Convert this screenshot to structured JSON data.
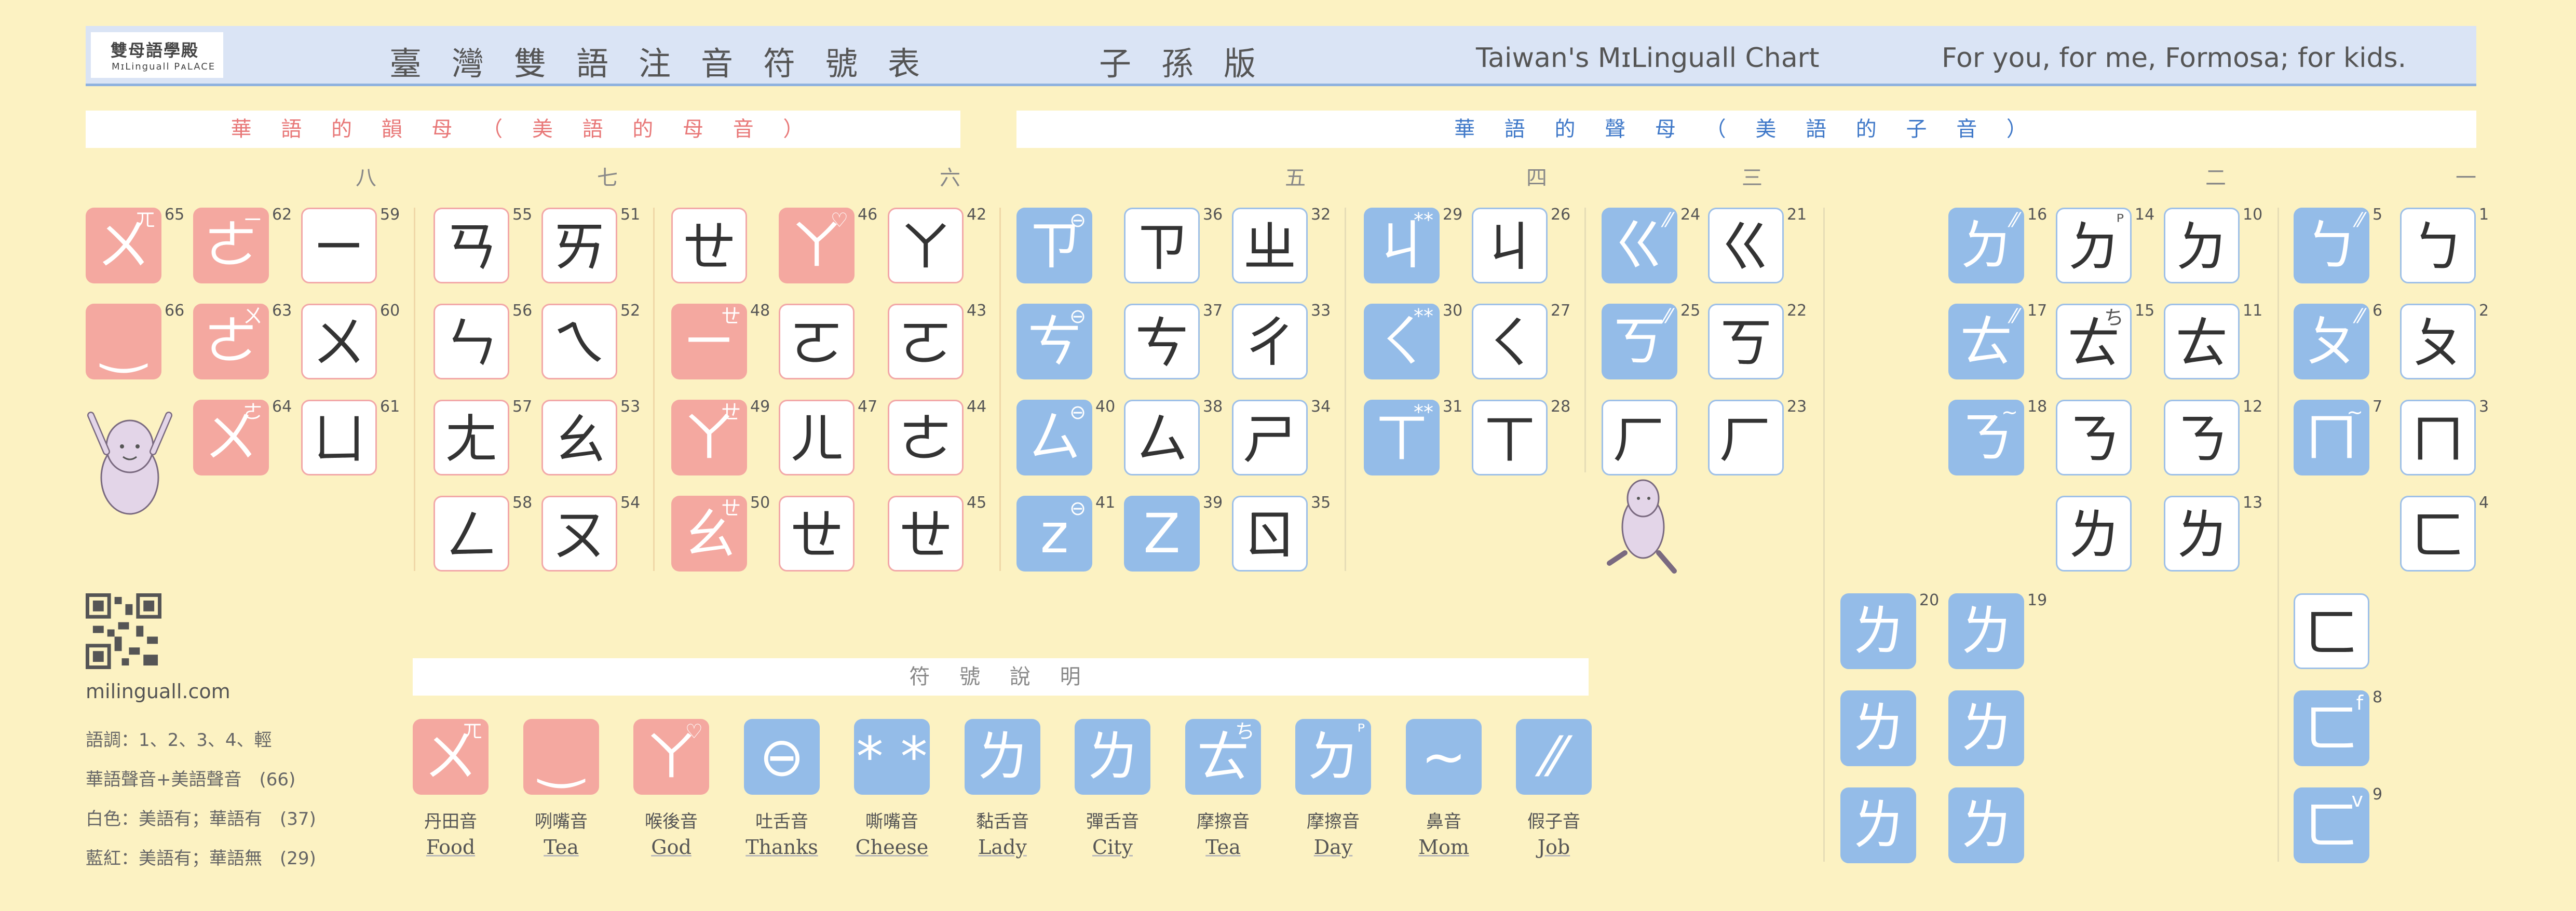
{
  "header": {
    "logo_main": "雙母語學殿",
    "logo_sub": "MɪLinguall PᴀLACE",
    "title_parts": [
      "臺灣雙語注音符號表",
      "子孫版"
    ],
    "title_en": "Taiwan's MɪLinguall Chart",
    "slogan": "For you, for me, Formosa; for kids."
  },
  "sections": {
    "vowels_bar": "華 語 的 韻 母 （ 美 語 的 母 音 ）",
    "consonants_bar": "華 語 的 聲 母 （ 美 語 的 子 音 ）",
    "legend_bar": "符 號 說 明"
  },
  "column_numbers": [
    "八",
    "七",
    "六",
    "五",
    "四",
    "三",
    "二",
    "一"
  ],
  "tiles": [
    {
      "id": "t1",
      "glyph": "ㄅ",
      "num": "1",
      "style": "w-b",
      "mark": ""
    },
    {
      "id": "t2",
      "glyph": "ㄆ",
      "num": "2",
      "style": "w-b",
      "mark": ""
    },
    {
      "id": "t3",
      "glyph": "ㄇ",
      "num": "3",
      "style": "w-b",
      "mark": ""
    },
    {
      "id": "t4",
      "glyph": "ㄈ",
      "num": "4",
      "style": "w-b",
      "mark": ""
    },
    {
      "id": "t5",
      "glyph": "ㄅ",
      "num": "5",
      "style": "f-b",
      "mark": "⁄⁄"
    },
    {
      "id": "t6",
      "glyph": "ㄆ",
      "num": "6",
      "style": "f-b",
      "mark": "⁄⁄"
    },
    {
      "id": "t7",
      "glyph": "ㄇ",
      "num": "7",
      "style": "f-b",
      "mark": "~"
    },
    {
      "id": "t8",
      "glyph": "ㄈ",
      "num": "8",
      "style": "f-b",
      "mark": "f"
    },
    {
      "id": "t9",
      "glyph": "ㄈ",
      "num": "9",
      "style": "f-b",
      "mark": "v"
    },
    {
      "id": "t9b",
      "glyph": "ㄈ",
      "num": "",
      "style": "w-b",
      "mark": ""
    },
    {
      "id": "t10",
      "glyph": "ㄉ",
      "num": "10",
      "style": "w-b",
      "mark": ""
    },
    {
      "id": "t11",
      "glyph": "ㄊ",
      "num": "11",
      "style": "w-b",
      "mark": ""
    },
    {
      "id": "t12",
      "glyph": "ㄋ",
      "num": "12",
      "style": "w-b",
      "mark": ""
    },
    {
      "id": "t13",
      "glyph": "ㄌ",
      "num": "13",
      "style": "w-b",
      "mark": ""
    },
    {
      "id": "t14",
      "glyph": "ㄉ",
      "num": "14",
      "style": "w-b",
      "mark": "ᴾ"
    },
    {
      "id": "t15",
      "glyph": "ㄊ",
      "num": "15",
      "style": "w-b",
      "mark": "ち"
    },
    {
      "id": "t13b",
      "glyph": "ㄋ",
      "num": "",
      "style": "w-b",
      "mark": ""
    },
    {
      "id": "t13c",
      "glyph": "ㄌ",
      "num": "",
      "style": "w-b",
      "mark": ""
    },
    {
      "id": "t16",
      "glyph": "ㄉ",
      "num": "16",
      "style": "f-b",
      "mark": "⁄⁄"
    },
    {
      "id": "t17",
      "glyph": "ㄊ",
      "num": "17",
      "style": "f-b",
      "mark": "⁄⁄"
    },
    {
      "id": "t18",
      "glyph": "ㄋ",
      "num": "18",
      "style": "f-b",
      "mark": "~"
    },
    {
      "id": "t19",
      "glyph": "ㄌ",
      "num": "19",
      "style": "f-b",
      "mark": ""
    },
    {
      "id": "t20",
      "glyph": "ㄌ",
      "num": "20",
      "style": "f-b",
      "mark": ""
    },
    {
      "id": "t21",
      "glyph": "ㄍ",
      "num": "21",
      "style": "w-b",
      "mark": ""
    },
    {
      "id": "t22",
      "glyph": "ㄎ",
      "num": "22",
      "style": "w-b",
      "mark": ""
    },
    {
      "id": "t23",
      "glyph": "ㄏ",
      "num": "23",
      "style": "w-b",
      "mark": ""
    },
    {
      "id": "t24",
      "glyph": "ㄍ",
      "num": "24",
      "style": "f-b",
      "mark": "⁄⁄"
    },
    {
      "id": "t25",
      "glyph": "ㄎ",
      "num": "25",
      "style": "f-b",
      "mark": "⁄⁄"
    },
    {
      "id": "t23b",
      "glyph": "ㄏ",
      "num": "",
      "style": "w-b",
      "mark": ""
    },
    {
      "id": "t26",
      "glyph": "ㄐ",
      "num": "26",
      "style": "w-b",
      "mark": ""
    },
    {
      "id": "t27",
      "glyph": "ㄑ",
      "num": "27",
      "style": "w-b",
      "mark": ""
    },
    {
      "id": "t28",
      "glyph": "ㄒ",
      "num": "28",
      "style": "w-b",
      "mark": ""
    },
    {
      "id": "t29",
      "glyph": "ㄐ",
      "num": "29",
      "style": "f-b",
      "mark": "**"
    },
    {
      "id": "t30",
      "glyph": "ㄑ",
      "num": "30",
      "style": "f-b",
      "mark": "**"
    },
    {
      "id": "t31",
      "glyph": "ㄒ",
      "num": "31",
      "style": "f-b",
      "mark": "**"
    },
    {
      "id": "t32",
      "glyph": "ㄓ",
      "num": "32",
      "style": "w-b",
      "mark": ""
    },
    {
      "id": "t33",
      "glyph": "ㄔ",
      "num": "33",
      "style": "w-b",
      "mark": ""
    },
    {
      "id": "t34",
      "glyph": "ㄕ",
      "num": "34",
      "style": "w-b",
      "mark": ""
    },
    {
      "id": "t35",
      "glyph": "ㄖ",
      "num": "35",
      "style": "w-b",
      "mark": ""
    },
    {
      "id": "t36",
      "glyph": "ㄗ",
      "num": "36",
      "style": "w-b",
      "mark": ""
    },
    {
      "id": "t37",
      "glyph": "ㄘ",
      "num": "37",
      "style": "w-b",
      "mark": ""
    },
    {
      "id": "t38",
      "glyph": "ㄙ",
      "num": "38",
      "style": "w-b",
      "mark": ""
    },
    {
      "id": "t39",
      "glyph": "Z",
      "num": "39",
      "style": "f-b",
      "mark": ""
    },
    {
      "id": "t36b",
      "glyph": "ㄗ",
      "num": "",
      "style": "f-b",
      "mark": "⊖"
    },
    {
      "id": "t37b",
      "glyph": "ㄘ",
      "num": "",
      "style": "f-b",
      "mark": "⊖"
    },
    {
      "id": "t40",
      "glyph": "ㄙ",
      "num": "40",
      "style": "f-b",
      "mark": "⊖"
    },
    {
      "id": "t41",
      "glyph": "z",
      "num": "41",
      "style": "f-b",
      "mark": "⊖"
    },
    {
      "id": "t42",
      "glyph": "ㄚ",
      "num": "42",
      "style": "w-r",
      "mark": ""
    },
    {
      "id": "t43",
      "glyph": "ㄛ",
      "num": "43",
      "style": "w-r",
      "mark": ""
    },
    {
      "id": "t44",
      "glyph": "ㄜ",
      "num": "44",
      "style": "w-r",
      "mark": ""
    },
    {
      "id": "t45",
      "glyph": "ㄝ",
      "num": "45",
      "style": "w-r",
      "mark": ""
    },
    {
      "id": "t46",
      "glyph": "ㄚ",
      "num": "46",
      "style": "f-r",
      "mark": "♡"
    },
    {
      "id": "t43b",
      "glyph": "ㄛ",
      "num": "",
      "style": "w-r",
      "mark": ""
    },
    {
      "id": "t47",
      "glyph": "ㄦ",
      "num": "47",
      "style": "w-r",
      "mark": ""
    },
    {
      "id": "t45b",
      "glyph": "ㄝ",
      "num": "",
      "style": "w-r",
      "mark": ""
    },
    {
      "id": "t45c",
      "glyph": "ㄝ",
      "num": "",
      "style": "w-r",
      "mark": ""
    },
    {
      "id": "t48",
      "glyph": "ㄧ",
      "num": "48",
      "style": "f-r",
      "mark": "ㄝ"
    },
    {
      "id": "t49",
      "glyph": "ㄚ",
      "num": "49",
      "style": "f-r",
      "mark": "ㄝ"
    },
    {
      "id": "t50",
      "glyph": "ㄠ",
      "num": "50",
      "style": "f-r",
      "mark": "ㄝ"
    },
    {
      "id": "t51",
      "glyph": "ㄞ",
      "num": "51",
      "style": "w-r",
      "mark": ""
    },
    {
      "id": "t52",
      "glyph": "ㄟ",
      "num": "52",
      "style": "w-r",
      "mark": ""
    },
    {
      "id": "t53",
      "glyph": "ㄠ",
      "num": "53",
      "style": "w-r",
      "mark": ""
    },
    {
      "id": "t54",
      "glyph": "ㄡ",
      "num": "54",
      "style": "w-r",
      "mark": ""
    },
    {
      "id": "t55",
      "glyph": "ㄢ",
      "num": "55",
      "style": "w-r",
      "mark": ""
    },
    {
      "id": "t56",
      "glyph": "ㄣ",
      "num": "56",
      "style": "w-r",
      "mark": ""
    },
    {
      "id": "t57",
      "glyph": "ㄤ",
      "num": "57",
      "style": "w-r",
      "mark": ""
    },
    {
      "id": "t58",
      "glyph": "ㄥ",
      "num": "58",
      "style": "w-r",
      "mark": ""
    },
    {
      "id": "t59",
      "glyph": "ㄧ",
      "num": "59",
      "style": "w-r",
      "mark": ""
    },
    {
      "id": "t60",
      "glyph": "ㄨ",
      "num": "60",
      "style": "w-r",
      "mark": ""
    },
    {
      "id": "t61",
      "glyph": "ㄩ",
      "num": "61",
      "style": "w-r",
      "mark": ""
    },
    {
      "id": "t62",
      "glyph": "ㄜ",
      "num": "62",
      "style": "f-r",
      "mark": "ㄧ"
    },
    {
      "id": "t63",
      "glyph": "ㄜ",
      "num": "63",
      "style": "f-r",
      "mark": "ㄨ"
    },
    {
      "id": "t64",
      "glyph": "ㄨ",
      "num": "64",
      "style": "f-r",
      "mark": "ㄜ"
    },
    {
      "id": "t65",
      "glyph": "ㄨ",
      "num": "65",
      "style": "f-r",
      "mark": "ㄫ"
    },
    {
      "id": "t66",
      "glyph": "‿",
      "num": "66",
      "style": "f-r",
      "mark": ""
    }
  ],
  "legend": [
    {
      "glyph": "ㄨ",
      "mark": "ㄫ",
      "style": "f-r",
      "cn": "丹田音",
      "en": "Food"
    },
    {
      "glyph": "‿",
      "mark": "",
      "style": "f-r",
      "cn": "咧嘴音",
      "en": "Tea"
    },
    {
      "glyph": "ㄚ",
      "mark": "♡",
      "style": "f-r",
      "cn": "喉後音",
      "en": "God"
    },
    {
      "glyph": "⊖",
      "mark": "",
      "style": "f-b",
      "cn": "吐舌音",
      "en": "Thanks"
    },
    {
      "glyph": "* *",
      "mark": "",
      "style": "f-b",
      "cn": "嘶嘴音",
      "en": "Cheese"
    },
    {
      "glyph": "ㄌ",
      "mark": "",
      "style": "f-b",
      "cn": "黏舌音",
      "en": "Lady"
    },
    {
      "glyph": "ㄌ",
      "mark": "",
      "style": "f-b",
      "cn": "彈舌音",
      "en": "City"
    },
    {
      "glyph": "ㄊ",
      "mark": "ち",
      "style": "f-b",
      "cn": "摩擦音",
      "en": "Tea"
    },
    {
      "glyph": "ㄉ",
      "mark": "ᴾ",
      "style": "f-b",
      "cn": "摩擦音",
      "en": "Day"
    },
    {
      "glyph": "~",
      "mark": "",
      "style": "f-b",
      "cn": "鼻音",
      "en": "Mom"
    },
    {
      "glyph": "⁄⁄",
      "mark": "",
      "style": "f-b",
      "cn": "假子音",
      "en": "Job"
    }
  ],
  "sidebar": {
    "website": "milinguall.com",
    "tones": "語調：1、2、3、4、輕",
    "line1": "華語聲音+美語聲音　(66)",
    "line2": "白色：美語有；華語有　(37)",
    "line3": "藍紅：美語有；華語無　(29)"
  },
  "colors": {
    "background": "#FCF2C2",
    "header": "#DAE4F5",
    "red_fill": "#F4A8A0",
    "blue_fill": "#94BCE8",
    "red_text": "#E87878",
    "blue_text": "#3F78C8"
  }
}
